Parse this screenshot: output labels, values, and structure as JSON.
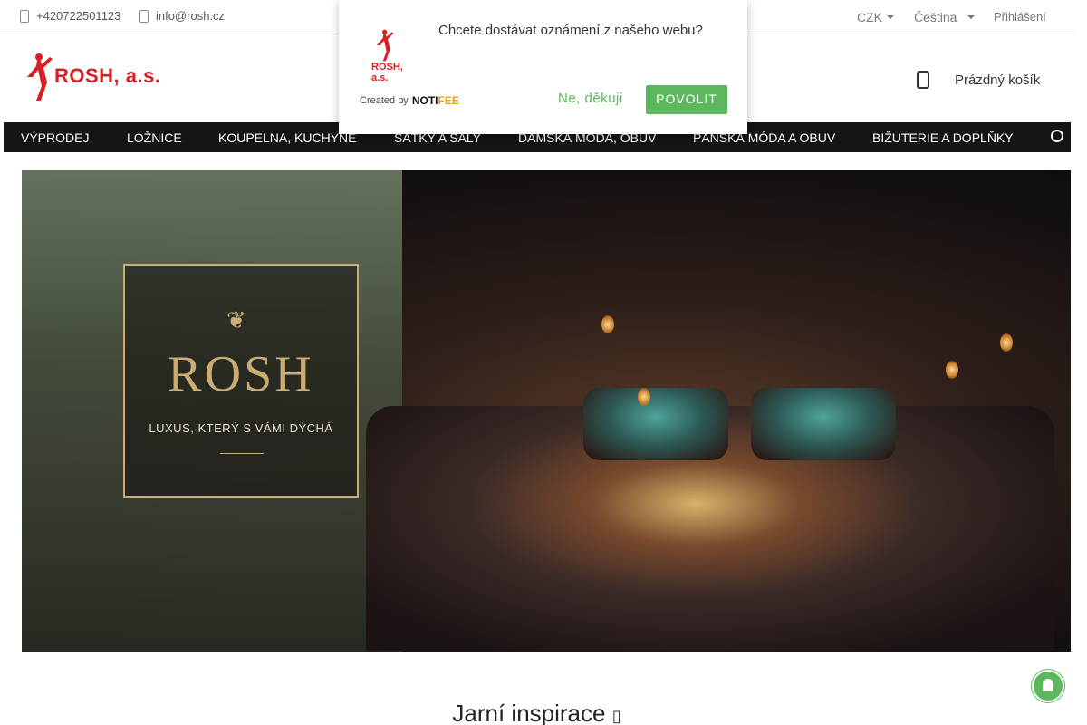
{
  "topbar": {
    "phone": "+420722501123",
    "email": "info@rosh.cz",
    "currency": "CZK",
    "language": "Čeština",
    "login": "Přihlášení"
  },
  "header": {
    "logo_text": "ROSH, a.s.",
    "cart_label": "Prázdný košík"
  },
  "nav": {
    "items": [
      "VÝPRODEJ",
      "LOŽNICE",
      "KOUPELNA, KUCHYNĚ",
      "ŠÁTKY A ŠÁLY",
      "DÁMSKÁ MÓDA, OBUV",
      "PÁNSKÁ MÓDA A OBUV",
      "BIŽUTERIE A DOPLŇKY"
    ]
  },
  "hero": {
    "brand": "ROSH",
    "tagline": "LUXUS, KTERÝ S VÁMI DÝCHÁ"
  },
  "section": {
    "title": "Jarní inspirace"
  },
  "popup": {
    "logo_text": "ROSH, a.s.",
    "message": "Chcete dostávat oznámení z našeho webu?",
    "created_by": "Created by",
    "brand_a": "NOTI",
    "brand_b": "FEE",
    "deny": "Ne, děkuji",
    "allow": "POVOLIT"
  },
  "colors": {
    "accent_green": "#5cb85c",
    "brand_red": "#d81f26",
    "nav_bg": "#151515",
    "gold": "#c9ad74"
  }
}
